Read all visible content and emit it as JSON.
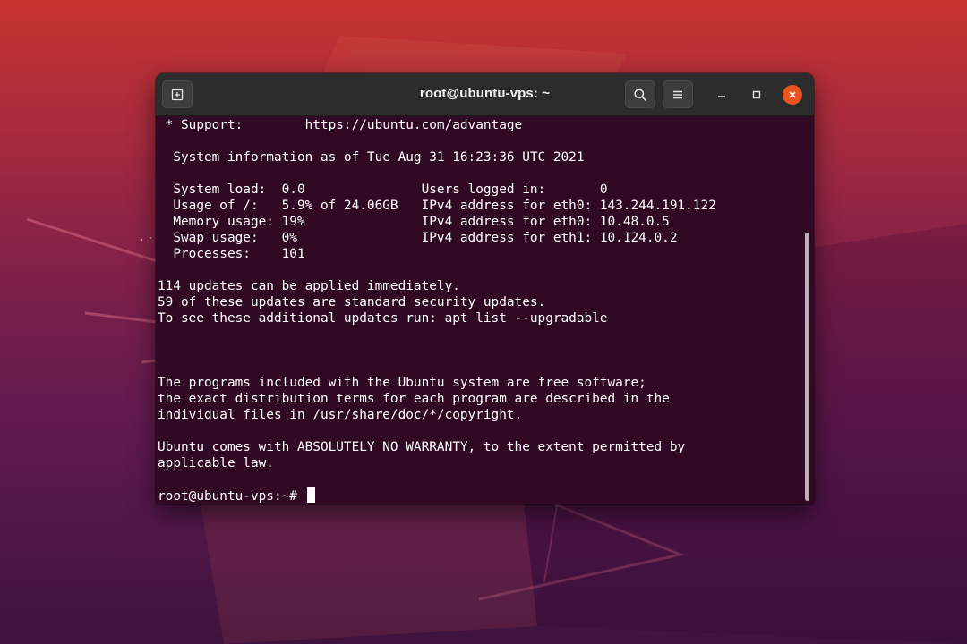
{
  "window": {
    "title": "root@ubuntu-vps: ~"
  },
  "titlebar": {
    "new_tab_icon": "new-tab-icon",
    "search_icon": "search-icon",
    "menu_icon": "hamburger-menu-icon",
    "minimize_icon": "minimize-icon",
    "maximize_icon": "maximize-icon",
    "close_icon": "close-icon"
  },
  "colors": {
    "terminal_background": "#300a24",
    "titlebar_background": "#2c2c2c",
    "close_button": "#e95420",
    "text": "#ffffff"
  },
  "terminal": {
    "lines": [
      " * Support:        https://ubuntu.com/advantage",
      "",
      "  System information as of Tue Aug 31 16:23:36 UTC 2021",
      "",
      "  System load:  0.0               Users logged in:       0",
      "  Usage of /:   5.9% of 24.06GB   IPv4 address for eth0: 143.244.191.122",
      "  Memory usage: 19%               IPv4 address for eth0: 10.48.0.5",
      "  Swap usage:   0%                IPv4 address for eth1: 10.124.0.2",
      "  Processes:    101",
      "",
      "114 updates can be applied immediately.",
      "59 of these updates are standard security updates.",
      "To see these additional updates run: apt list --upgradable",
      "",
      "",
      "",
      "The programs included with the Ubuntu system are free software;",
      "the exact distribution terms for each program are described in the",
      "individual files in /usr/share/doc/*/copyright.",
      "",
      "Ubuntu comes with ABSOLUTELY NO WARRANTY, to the extent permitted by",
      "applicable law."
    ],
    "prompt": "root@ubuntu-vps:~# "
  }
}
